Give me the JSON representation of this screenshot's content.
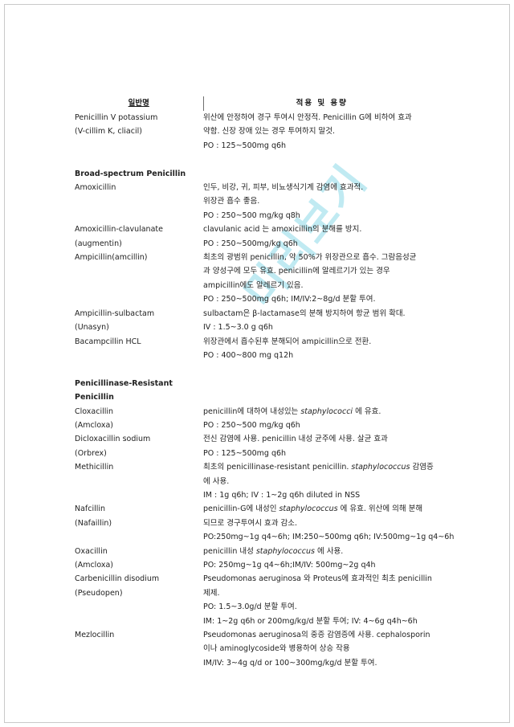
{
  "document": {
    "watermark_text": "미리보기",
    "watermark_color": "#bde9f2"
  },
  "table": {
    "headers": {
      "col1": "일반명",
      "col2": "적용 및 용량"
    },
    "rows": [
      {
        "name": "Penicillin V potassium",
        "bold": false,
        "dose": "위산에 안정하여 경구 투여시 안정적. Penicillin G에 비하여 효과"
      },
      {
        "name": "(V-cillim K, cliacil)",
        "bold": false,
        "dose": "약함. 신장 장애 있는 경우 투여하지 말것."
      },
      {
        "name": "",
        "bold": false,
        "dose": "PO : 125~500mg q6h"
      },
      {
        "name": "",
        "bold": false,
        "dose": ""
      },
      {
        "name": "Broad-spectrum Penicillin",
        "bold": true,
        "dose": ""
      },
      {
        "name": "Amoxicillin",
        "bold": false,
        "dose": "인두, 비강, 귀, 피부, 비뇨생식기계 감염에 효과적."
      },
      {
        "name": "",
        "bold": false,
        "dose": "위장관 흡수 좋음."
      },
      {
        "name": "",
        "bold": false,
        "dose": "PO : 250~500 mg/kg q8h"
      },
      {
        "name": "Amoxicillin-clavulanate",
        "bold": false,
        "dose": "clavulanic acid 는 amoxicillin의 분해를 방지."
      },
      {
        "name": "(augmentin)",
        "bold": false,
        "dose": "PO : 250~500mg/kg q6h"
      },
      {
        "name": "Ampicillin(amcillin)",
        "bold": false,
        "dose": "최초의 광범위 penicillin, 약 50%가 위장관으로 흡수. 그람음성균"
      },
      {
        "name": "",
        "bold": false,
        "dose": "과 양성구에 모두 유효. penicillin에 알레르기가 있는 경우"
      },
      {
        "name": "",
        "bold": false,
        "dose": "ampicillin에도 알레르기 있음."
      },
      {
        "name": "",
        "bold": false,
        "dose": "PO : 250~500mg q6h; IM/IV:2~8g/d 분할 투여."
      },
      {
        "name": "Ampicillin-sulbactam",
        "bold": false,
        "dose": "sulbactam은 β-lactamase의 분해 방지하여 항균 범위 확대."
      },
      {
        "name": "(Unasyn)",
        "bold": false,
        "dose": "IV : 1.5~3.0 g q6h"
      },
      {
        "name": "Bacampcillin HCL",
        "bold": false,
        "dose": "위장관에서 흡수된후 분해되어 ampicillin으로 전환."
      },
      {
        "name": "",
        "bold": false,
        "dose": "PO : 400~800 mg q12h"
      },
      {
        "name": "",
        "bold": false,
        "dose": ""
      },
      {
        "name": "Penicillinase-Resistant",
        "bold": true,
        "dose": ""
      },
      {
        "name": "Penicillin",
        "bold": true,
        "dose": ""
      },
      {
        "name": "Cloxacillin",
        "bold": false,
        "dose_html": "penicillin에 대하여 내성있는 <i>staphylococci</i> 에 유효."
      },
      {
        "name": "(Amcloxa)",
        "bold": false,
        "dose": "PO : 250~500 mg/kg q6h"
      },
      {
        "name": "Dicloxacillin sodium",
        "bold": false,
        "dose": "전신 감염에 사용. penicillin 내성 균주에 사용. 살균 효과"
      },
      {
        "name": "(Orbrex)",
        "bold": false,
        "dose": "PO : 125~500mg q6h"
      },
      {
        "name": "Methicillin",
        "bold": false,
        "dose_html": "최초의 penicillinase-resistant penicillin. <i>staphylococcus</i> 감염증"
      },
      {
        "name": "",
        "bold": false,
        "dose": "에 사용."
      },
      {
        "name": "",
        "bold": false,
        "dose": "IM : 1g q6h; IV : 1~2g q6h diluted in NSS"
      },
      {
        "name": "Nafcillin",
        "bold": false,
        "dose_html": "penicillin-G에 내성인 <i>staphylococcus</i> 에 유효. 위산에 의해 분해"
      },
      {
        "name": "(Nafaillin)",
        "bold": false,
        "dose": "되므로 경구투여시 효과 감소."
      },
      {
        "name": "",
        "bold": false,
        "dose": "PO:250mg~1g q4~6h; IM:250~500mg q6h; IV:500mg~1g q4~6h"
      },
      {
        "name": "Oxacillin",
        "bold": false,
        "dose_html": "penicillin 내성 <i>staphylococcus</i> 에 사용."
      },
      {
        "name": "(Amcloxa)",
        "bold": false,
        "dose": "PO: 250mg~1g q4~6h;IM/IV: 500mg~2g q4h"
      },
      {
        "name": "Carbenicillin disodium",
        "bold": false,
        "dose": "Pseudomonas aeruginosa 와 Proteus에 효과적인 최초 penicillin"
      },
      {
        "name": "(Pseudopen)",
        "bold": false,
        "dose": "제제."
      },
      {
        "name": "",
        "bold": false,
        "dose": "PO: 1.5~3.0g/d 분할 투여."
      },
      {
        "name": "",
        "bold": false,
        "dose": "IM: 1~2g q6h or 200mg/kg/d 분할 투여; IV: 4~6g q4h~6h"
      },
      {
        "name": "Mezlocillin",
        "bold": false,
        "dose": "Pseudomonas aeruginosa의 중증 감염증에 사용. cephalosporin"
      },
      {
        "name": "",
        "bold": false,
        "dose": "이나 aminoglycoside와 병용하여 상승 작용"
      },
      {
        "name": "",
        "bold": false,
        "dose": "IM/IV: 3~4g q/d or 100~300mg/kg/d 분할 투여."
      }
    ]
  }
}
